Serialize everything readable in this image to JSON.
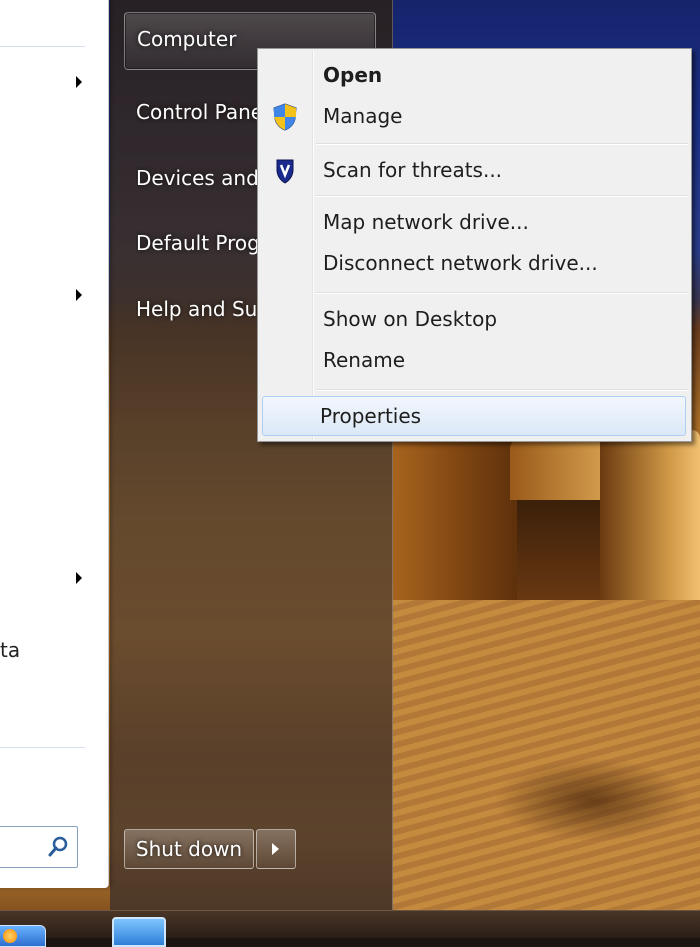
{
  "start_menu": {
    "left_pane": {
      "partial_text": "ta",
      "search_placeholder": ""
    },
    "right_pane": {
      "items": [
        {
          "label": "Computer"
        },
        {
          "label": "Control Pane"
        },
        {
          "label": "Devices and"
        },
        {
          "label": "Default Prog"
        },
        {
          "label": "Help and Su"
        }
      ],
      "shutdown_label": "Shut down"
    }
  },
  "context_menu": {
    "items": [
      {
        "label": "Open",
        "icon": null
      },
      {
        "label": "Manage",
        "icon": "uac-shield-icon"
      },
      {
        "label": "Scan for threats...",
        "icon": "antivirus-shield-icon"
      },
      {
        "label": "Map network drive...",
        "icon": null
      },
      {
        "label": "Disconnect network drive...",
        "icon": null
      },
      {
        "label": "Show on Desktop",
        "icon": null
      },
      {
        "label": "Rename",
        "icon": null
      },
      {
        "label": "Properties",
        "icon": null
      }
    ],
    "highlighted": "Properties"
  },
  "colors": {
    "menu_background": "#f0f0f0",
    "hover_border": "#aecdf2",
    "start_glass": "#3c2e26"
  }
}
